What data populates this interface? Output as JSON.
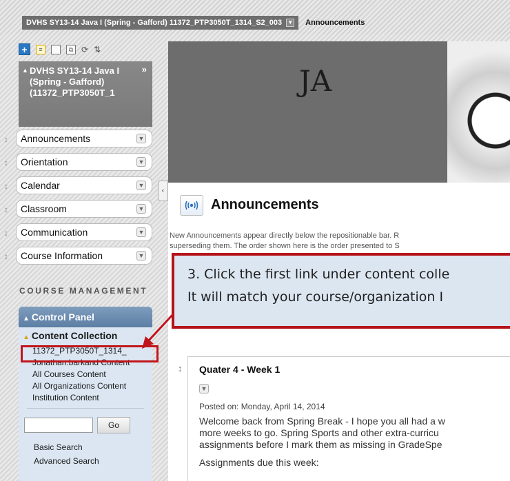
{
  "breadcrumb": {
    "course": "DVHS SY13-14 Java I (Spring - Gafford) 11372_PTP3050T_1314_S2_003",
    "current": "Announcements"
  },
  "course_menu": {
    "title": "DVHS SY13-14 Java I (Spring - Gafford) (11372_PTP3050T_1",
    "items": [
      {
        "label": "Announcements"
      },
      {
        "label": "Orientation"
      },
      {
        "label": "Calendar"
      },
      {
        "label": "Classroom"
      },
      {
        "label": "Communication"
      },
      {
        "label": "Course Information"
      }
    ]
  },
  "course_management": {
    "heading": "COURSE MANAGEMENT",
    "control_panel": "Control Panel",
    "content_collection": "Content Collection",
    "links": [
      "11372_PTP3050T_1314_",
      "Jonathan.barkand Content",
      "All Courses Content",
      "All Organizations Content",
      "Institution Content"
    ],
    "search_placeholder": "",
    "go_label": "Go",
    "search_links": [
      "Basic Search",
      "Advanced Search"
    ]
  },
  "banner": {
    "logo_text": "JA"
  },
  "page": {
    "title": "Announcements",
    "intro_line1": "New Announcements appear directly below the repositionable bar. R",
    "intro_line2": "superseding them. The order shown here is the order presented to S"
  },
  "callout": {
    "line1": "3. Click the first link under content colle",
    "line2": "It will match your course/organization I"
  },
  "announcement": {
    "title": "Quater 4 - Week 1",
    "posted": "Posted on: Monday, April 14, 2014",
    "body_lines": [
      "Welcome back from Spring Break - I hope you all had a w",
      "more weeks to go.  Spring Sports and other extra-curricu",
      "assignments before I mark them as missing in GradeSpe"
    ],
    "due": "Assignments due this week:"
  },
  "colors": {
    "callout_border": "#b5131a",
    "callout_fill": "#dce6f1",
    "control_panel": "#6a8bb0"
  }
}
